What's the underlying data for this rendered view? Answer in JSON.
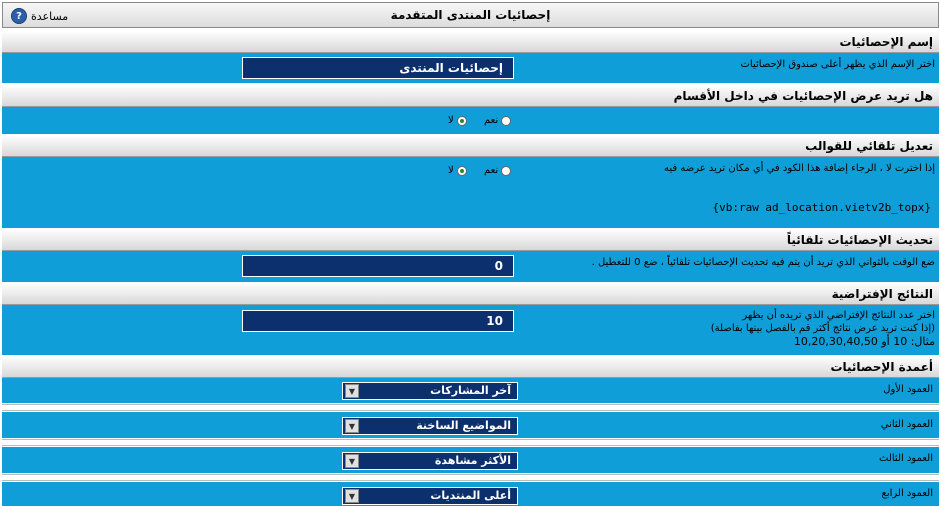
{
  "window": {
    "title": "إحصائيات المنتدى المتقدمة",
    "help_label": "مساعدة"
  },
  "sections": {
    "stats_name": {
      "heading": "إسم الإحصائيات",
      "description": "اختر الإسم الذي يظهر أعلى صندوق الإحصائيات",
      "value": "إحصائيات المنتدى"
    },
    "show_in_forums": {
      "heading": "هل تريد عرض الإحصائيات في داخل الأقسام",
      "yes_label": "نعم",
      "no_label": "لا",
      "selected": "no"
    },
    "auto_templates": {
      "heading": "تعديل تلقائي للقوالب",
      "description": "إذا اخترت لا ، الرجاء إضافة هذا الكود في أي مكان تريد عرضه فيه",
      "yes_label": "نعم",
      "no_label": "لا",
      "selected": "no",
      "code": "{vb:raw ad_location.vietv2b_topx}"
    },
    "auto_refresh": {
      "heading": "تحديث الإحصائيات تلقائياً",
      "description": "ضع الوقت بالثواني الذي تريد أن يتم فيه تحديث الإحصائيات تلقائياً ، ضع 0 للتعطيل .",
      "value": "0"
    },
    "default_results": {
      "heading": "النتائج الإفتراضية",
      "description_line1": "اختر عدد النتائج الإفتراضي الذي تريده أن يظهر",
      "description_line2": "(إذا كنت تريد عرض نتائج أكثر قم بالفصل بينها بفاصلة)",
      "description_line3": "مثال: 10 أو 10,20,30,40,50",
      "value": "10"
    },
    "columns": {
      "heading": "أعمدة الإحصائيات",
      "items": [
        {
          "label": "العمود الأول",
          "value": "آخر المشاركات"
        },
        {
          "label": "العمود الثاني",
          "value": "المواضيع الساخنة"
        },
        {
          "label": "العمود الثالث",
          "value": "الأكثر مشاهدة"
        },
        {
          "label": "العمود الرابع",
          "value": "أعلى المنتديات"
        }
      ]
    }
  },
  "colors": {
    "row_bg": "#0f9ed8",
    "field_bg": "#0c2f6e"
  }
}
